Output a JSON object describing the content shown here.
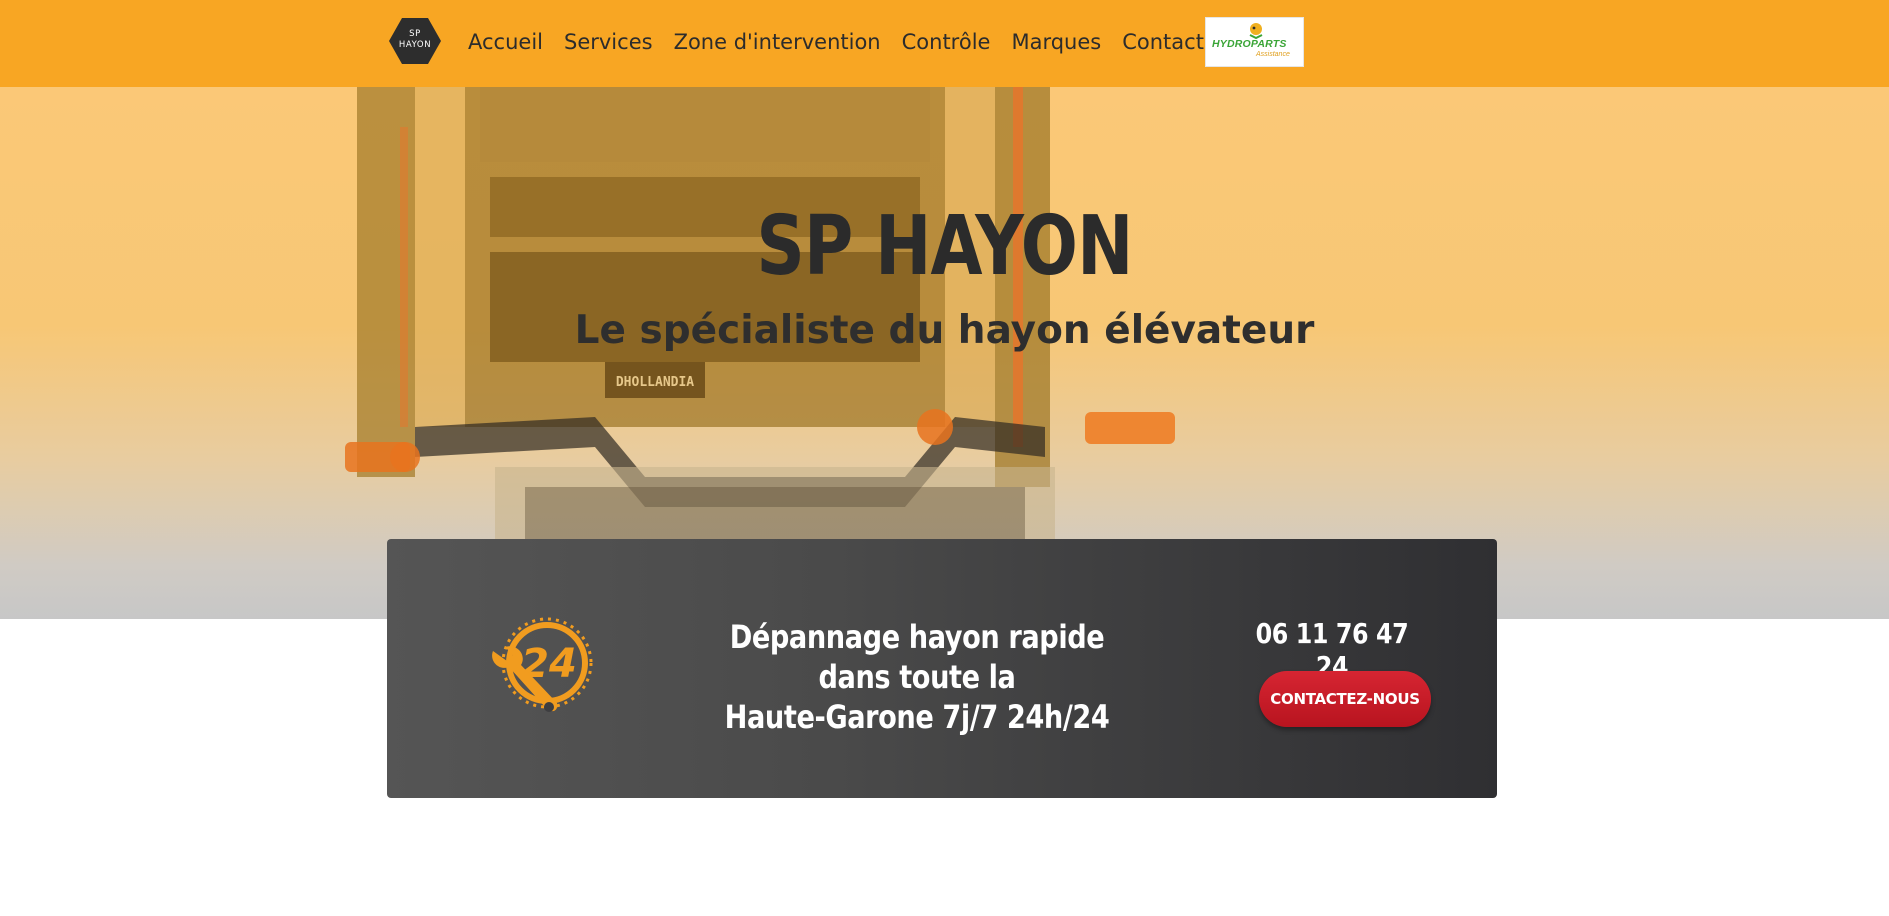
{
  "header": {
    "logo_line1": "SP",
    "logo_line2": "HAYON",
    "nav": [
      "Accueil",
      "Services",
      "Zone d'intervention",
      "Contrôle",
      "Marques",
      "Contact"
    ],
    "partner": {
      "name": "HYDROPARTS",
      "sub": "Assistance"
    }
  },
  "hero": {
    "title": "SP HAYON",
    "subtitle": "Le spécialiste du hayon élévateur",
    "plate_text": "DHOLLANDIA"
  },
  "banner": {
    "icon": "wrench-24h-icon",
    "text_line1": "Dépannage hayon rapide dans toute la",
    "text_line2": "Haute-Garone 7j/7 24h/24",
    "phone": "06 11 76 47 24",
    "cta": "CONTACTEZ-NOUS"
  },
  "colors": {
    "header_bg": "#f8a623",
    "accent_orange": "#f19c1f",
    "cta_red": "#c41c28",
    "banner_dark": "#3a3a3d",
    "text_dark": "#2b2b2b"
  }
}
